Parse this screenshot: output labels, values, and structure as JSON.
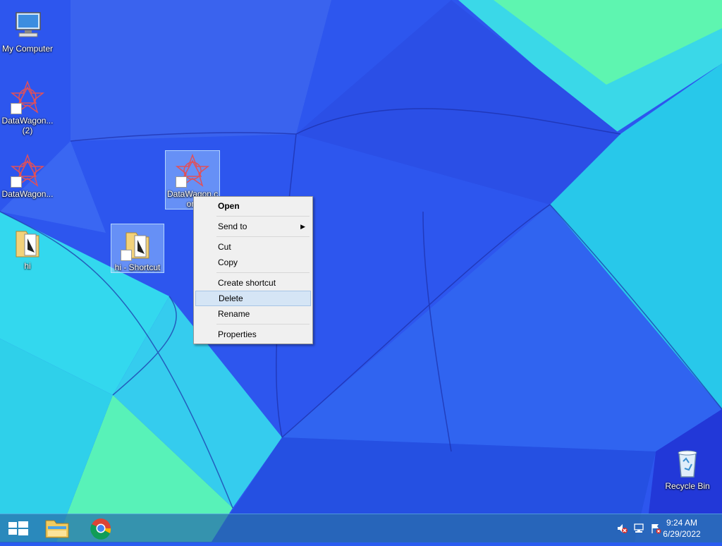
{
  "desktop": {
    "icons": [
      {
        "label": "My Computer",
        "icon": "computer-icon"
      },
      {
        "label": "DataWagon...",
        "label2": "(2)",
        "icon": "datawagon-icon"
      },
      {
        "label": "DataWagon...",
        "icon": "datawagon-icon"
      },
      {
        "label": "hi",
        "icon": "folder-icon"
      },
      {
        "label": "DataWagon.c",
        "label2": "om",
        "icon": "datawagon-icon"
      },
      {
        "label": "hi - Shortcut",
        "icon": "folder-shortcut-icon"
      },
      {
        "label": "Recycle Bin",
        "icon": "recycle-bin-icon"
      }
    ]
  },
  "context_menu": {
    "items": [
      {
        "label": "Open"
      },
      {
        "label": "Send to"
      },
      {
        "label": "Cut"
      },
      {
        "label": "Copy"
      },
      {
        "label": "Create shortcut"
      },
      {
        "label": "Delete"
      },
      {
        "label": "Rename"
      },
      {
        "label": "Properties"
      }
    ]
  },
  "taskbar": {
    "time": "9:24 AM",
    "date": "6/29/2022",
    "pinned": [
      "start-button",
      "file-explorer-icon",
      "chrome-icon"
    ],
    "tray": [
      "speaker-muted-icon",
      "network-icon",
      "action-center-flag-icon"
    ]
  }
}
